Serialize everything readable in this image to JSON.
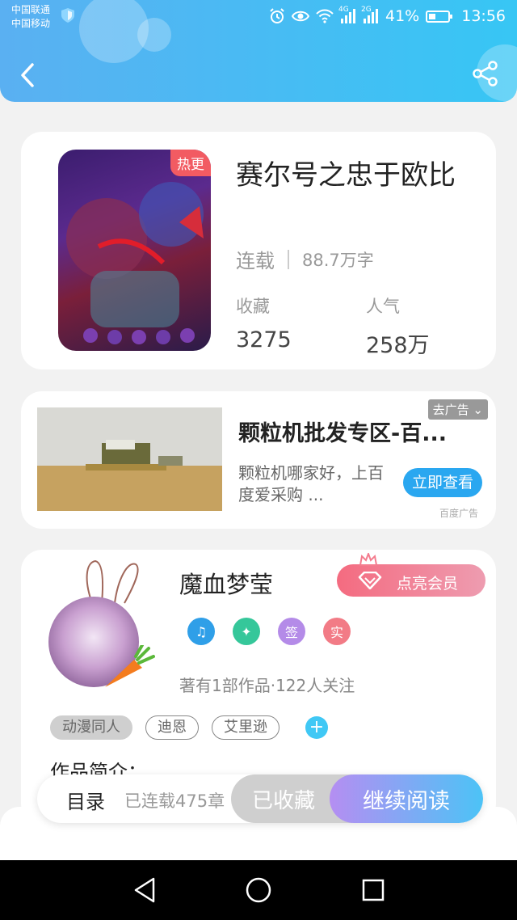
{
  "status_bar": {
    "carrier_1": "中国联通",
    "carrier_2": "中国移动",
    "network_1": "4G",
    "network_2": "2G",
    "battery": "41%",
    "time": "13:56"
  },
  "header": {
    "back_icon": "chevron-left-icon",
    "share_icon": "share-icon"
  },
  "book": {
    "title": "赛尔号之忠于欧比",
    "cover_tag": "热更",
    "status": "连载",
    "word_count": "88.7万字",
    "favorites_label": "收藏",
    "favorites_value": "3275",
    "popularity_label": "人气",
    "popularity_value": "258万"
  },
  "ad": {
    "tag": "去广告",
    "title": "颗粒机批发专区-百...",
    "description": "颗粒机哪家好，上百度爱采购 ...",
    "button": "立即查看",
    "source": "百度广告"
  },
  "author": {
    "name": "魔血梦莹",
    "vip_button": "点亮会员",
    "badges": [
      {
        "icon": "music-note-icon",
        "label": "",
        "color": "#2f9fe8"
      },
      {
        "icon": "handshake-icon",
        "label": "",
        "color": "#35c79a"
      },
      {
        "icon": "sign-in-badge",
        "label": "签",
        "color": "#b48be8"
      },
      {
        "icon": "verified-badge",
        "label": "实",
        "color": "#f27b86"
      }
    ],
    "stats": "著有1部作品·122人关注",
    "tags": [
      "动漫同人",
      "迪恩",
      "艾里逊"
    ],
    "add_tag": "+",
    "intro_heading": "作品简介："
  },
  "bottom_bar": {
    "toc": "目录",
    "chapter_count": "已连载475章",
    "favorited": "已收藏",
    "continue_reading": "继续阅读"
  },
  "colors": {
    "header_start": "#5ab0f2",
    "header_end": "#37c6f4",
    "hot_tag": "#f25b62",
    "ad_button": "#2aa7f0",
    "vip_start": "#f46b80",
    "read_start": "#b58ef2",
    "read_end": "#4cc3f6"
  }
}
